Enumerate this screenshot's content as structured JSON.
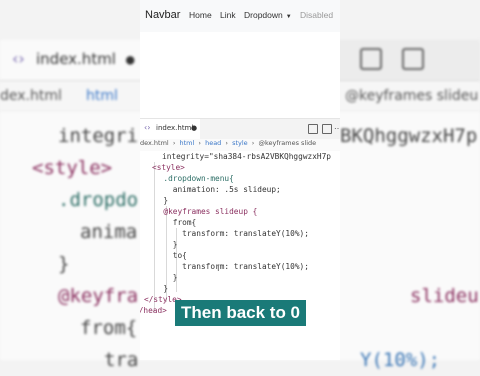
{
  "background": {
    "tab": {
      "name": "index.html",
      "dot": "●"
    },
    "breadcrumb": {
      "left": "dex.html",
      "middle": "html",
      "right": "@keyframes slideu"
    },
    "code_lines": [
      {
        "text": "integri",
        "tail": "BKQhggwzxH7p"
      },
      {
        "text": "<style>"
      },
      {
        "text": ".dropdo"
      },
      {
        "text": "anima"
      },
      {
        "text": "}"
      },
      {
        "text": "@keyfra",
        "tail": "slideu"
      },
      {
        "text": "from{"
      },
      {
        "text": "tra",
        "tail": "Y(10%);"
      }
    ]
  },
  "navbar": {
    "brand": "Navbar",
    "links": [
      "Home",
      "Link",
      "Dropdown",
      "Disabled"
    ]
  },
  "editor": {
    "tab_name": "index.html",
    "tab_dot": "●",
    "more": "…",
    "breadcrumbs": [
      "dex.html",
      "›",
      "html",
      "›",
      "head",
      "›",
      "style",
      "›",
      "@keyframes slide"
    ],
    "code": [
      "integrity=\"sha384-rbsA2VBKQhggwzxH7p",
      "<style>",
      "  .dropdown-menu{",
      "    animation: .5s slideup;",
      "  }",
      "  @keyframes slideup {",
      "    from{",
      "      transform: translateY(10%);",
      "    }",
      "    to{",
      "      transform: translateY(10%);",
      "    }",
      "  }",
      "</style>",
      "</head>"
    ],
    "cursor_glyph": "I"
  },
  "caption": "Then back to 0",
  "colors": {
    "caption_bg": "#1a7a78",
    "keyword": "#8a2f5f",
    "function": "#3a76b5"
  }
}
